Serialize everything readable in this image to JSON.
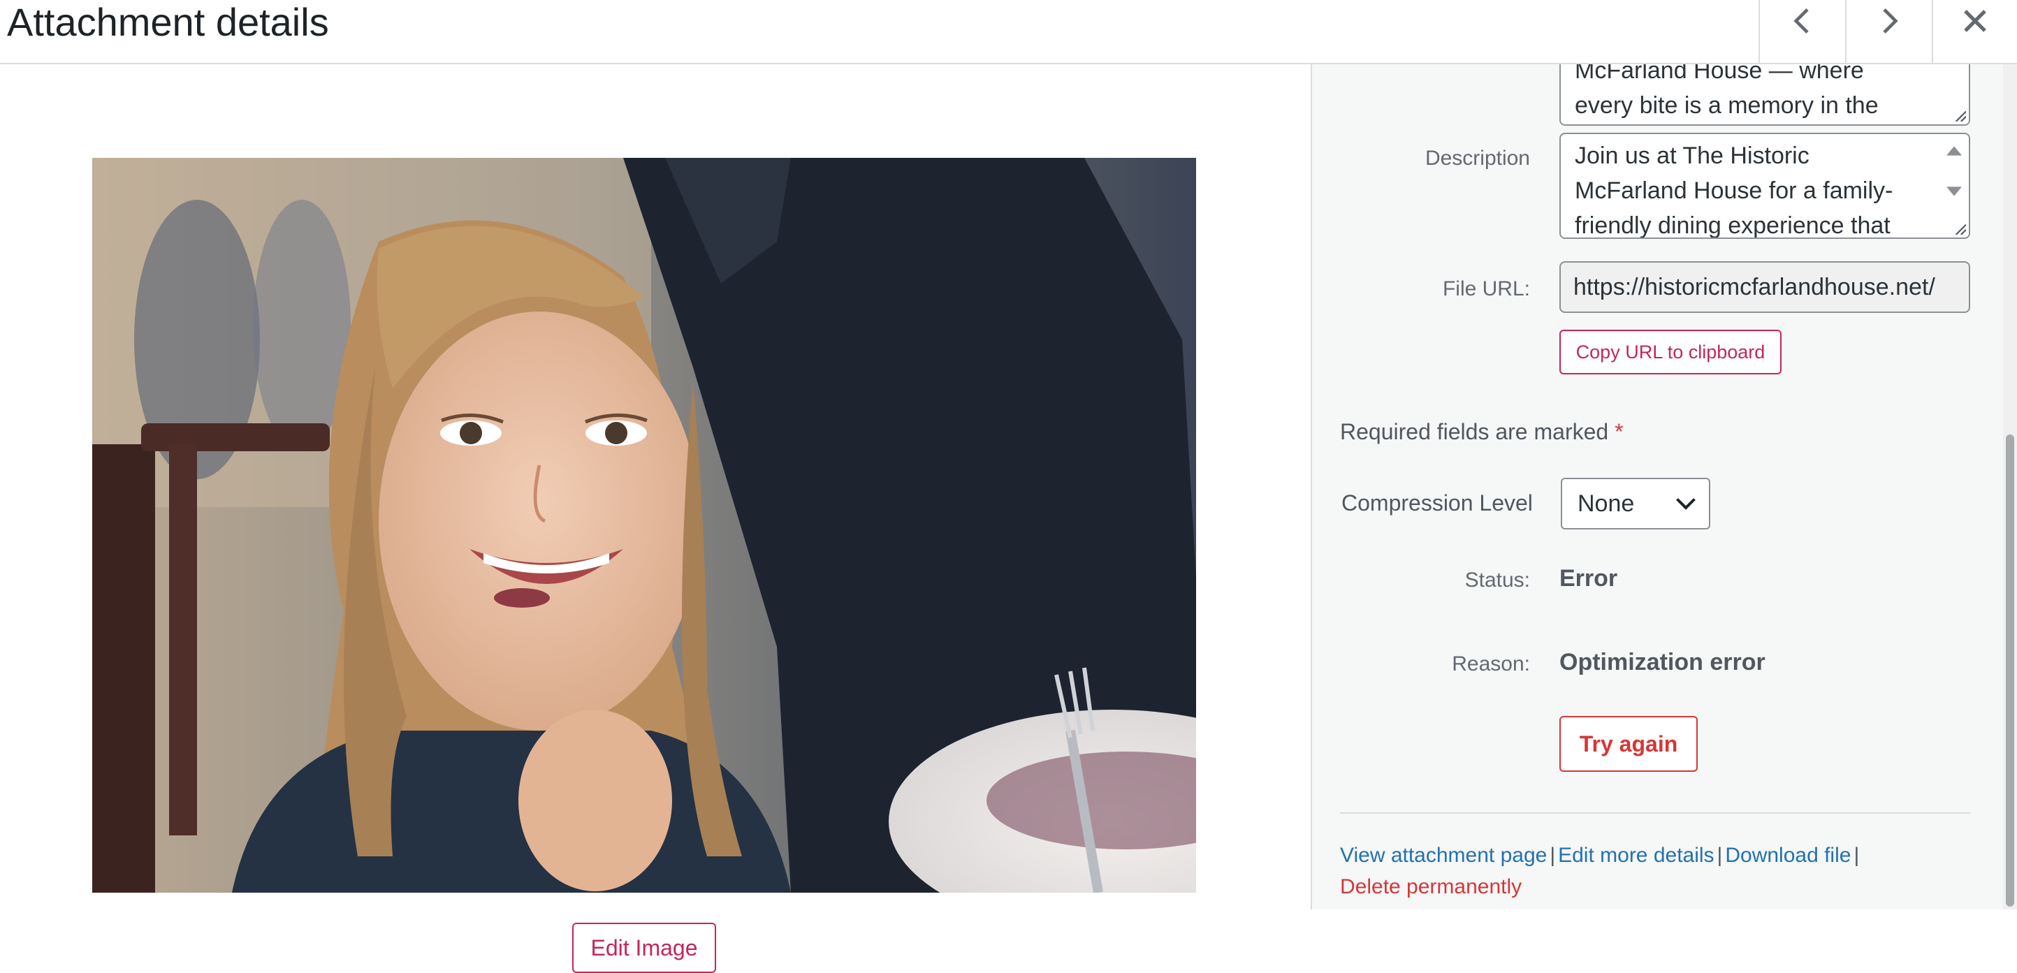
{
  "header": {
    "title": "Attachment details",
    "prev_icon": "chevron-left-icon",
    "next_icon": "chevron-right-icon",
    "close_icon": "close-icon"
  },
  "media": {
    "edit_image_label": "Edit Image"
  },
  "settings": {
    "caption_value": "McFarland House — where every bite is a memory in the",
    "description_label": "Description",
    "description_value": "Join us at The Historic McFarland House for a family-friendly dining experience that",
    "file_url_label": "File URL:",
    "file_url_value": "https://historicmcfarlandhouse.net/",
    "copy_url_label": "Copy URL to clipboard",
    "required_text": "Required fields are marked",
    "required_star": "*",
    "compression_label": "Compression Level",
    "compression_value": "None",
    "status_label": "Status:",
    "status_value": "Error",
    "reason_label": "Reason:",
    "reason_value": "Optimization error",
    "try_again_label": "Try again"
  },
  "links": {
    "view_attachment": "View attachment page",
    "edit_more": "Edit more details",
    "download": "Download file",
    "delete": "Delete permanently",
    "separator": "|"
  },
  "colors": {
    "accent_pink": "#c4265a",
    "error_red": "#d63638",
    "link_blue": "#2271b1"
  }
}
